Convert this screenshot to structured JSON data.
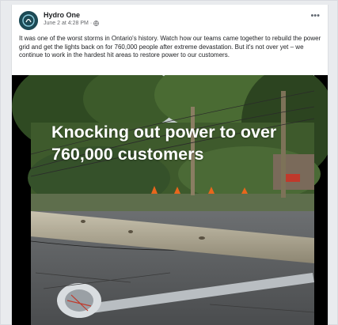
{
  "post": {
    "page_name": "Hydro One",
    "date": "June 2 at 4:28 PM",
    "separator": "·",
    "more_label": "•••",
    "caption": "It was one of the worst storms in Ontario's history. Watch how our teams came together to rebuild the power grid and get the lights back on for 760,000 people after extreme devastation. But it's not over yet – we continue to work in the hardest hit areas to restore power to our customers."
  },
  "video": {
    "headline_line1": "Knocking out power to over",
    "headline_line2": "760,000 customers"
  },
  "icons": {
    "avatar": "hydro-one-logo",
    "audience": "globe-icon",
    "menu": "more-options-icon"
  },
  "colors": {
    "avatar_bg": "#1d4a55",
    "accent_text": "#1c1e21",
    "muted_text": "#65676b"
  }
}
